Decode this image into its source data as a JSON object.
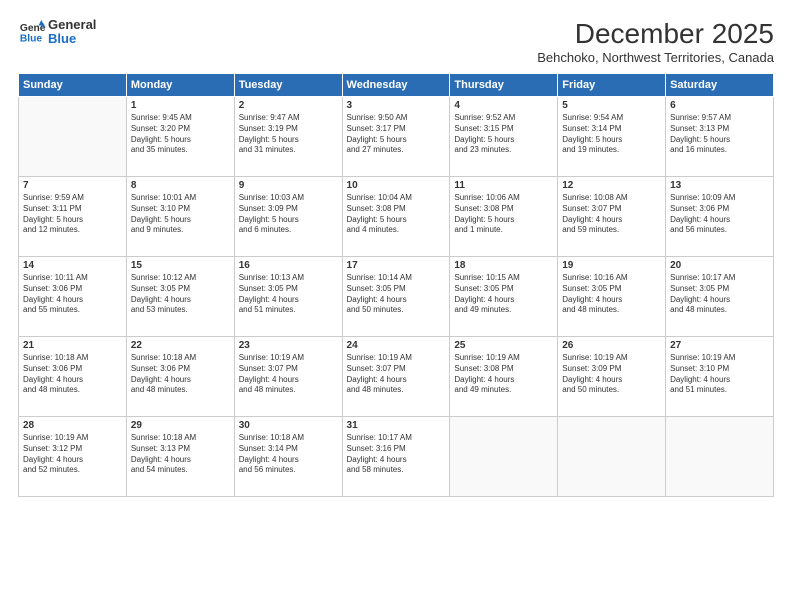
{
  "header": {
    "logo_line1": "General",
    "logo_line2": "Blue",
    "month_year": "December 2025",
    "location": "Behchoko, Northwest Territories, Canada"
  },
  "days_of_week": [
    "Sunday",
    "Monday",
    "Tuesday",
    "Wednesday",
    "Thursday",
    "Friday",
    "Saturday"
  ],
  "weeks": [
    [
      {
        "num": "",
        "info": ""
      },
      {
        "num": "1",
        "info": "Sunrise: 9:45 AM\nSunset: 3:20 PM\nDaylight: 5 hours\nand 35 minutes."
      },
      {
        "num": "2",
        "info": "Sunrise: 9:47 AM\nSunset: 3:19 PM\nDaylight: 5 hours\nand 31 minutes."
      },
      {
        "num": "3",
        "info": "Sunrise: 9:50 AM\nSunset: 3:17 PM\nDaylight: 5 hours\nand 27 minutes."
      },
      {
        "num": "4",
        "info": "Sunrise: 9:52 AM\nSunset: 3:15 PM\nDaylight: 5 hours\nand 23 minutes."
      },
      {
        "num": "5",
        "info": "Sunrise: 9:54 AM\nSunset: 3:14 PM\nDaylight: 5 hours\nand 19 minutes."
      },
      {
        "num": "6",
        "info": "Sunrise: 9:57 AM\nSunset: 3:13 PM\nDaylight: 5 hours\nand 16 minutes."
      }
    ],
    [
      {
        "num": "7",
        "info": "Sunrise: 9:59 AM\nSunset: 3:11 PM\nDaylight: 5 hours\nand 12 minutes."
      },
      {
        "num": "8",
        "info": "Sunrise: 10:01 AM\nSunset: 3:10 PM\nDaylight: 5 hours\nand 9 minutes."
      },
      {
        "num": "9",
        "info": "Sunrise: 10:03 AM\nSunset: 3:09 PM\nDaylight: 5 hours\nand 6 minutes."
      },
      {
        "num": "10",
        "info": "Sunrise: 10:04 AM\nSunset: 3:08 PM\nDaylight: 5 hours\nand 4 minutes."
      },
      {
        "num": "11",
        "info": "Sunrise: 10:06 AM\nSunset: 3:08 PM\nDaylight: 5 hours\nand 1 minute."
      },
      {
        "num": "12",
        "info": "Sunrise: 10:08 AM\nSunset: 3:07 PM\nDaylight: 4 hours\nand 59 minutes."
      },
      {
        "num": "13",
        "info": "Sunrise: 10:09 AM\nSunset: 3:06 PM\nDaylight: 4 hours\nand 56 minutes."
      }
    ],
    [
      {
        "num": "14",
        "info": "Sunrise: 10:11 AM\nSunset: 3:06 PM\nDaylight: 4 hours\nand 55 minutes."
      },
      {
        "num": "15",
        "info": "Sunrise: 10:12 AM\nSunset: 3:05 PM\nDaylight: 4 hours\nand 53 minutes."
      },
      {
        "num": "16",
        "info": "Sunrise: 10:13 AM\nSunset: 3:05 PM\nDaylight: 4 hours\nand 51 minutes."
      },
      {
        "num": "17",
        "info": "Sunrise: 10:14 AM\nSunset: 3:05 PM\nDaylight: 4 hours\nand 50 minutes."
      },
      {
        "num": "18",
        "info": "Sunrise: 10:15 AM\nSunset: 3:05 PM\nDaylight: 4 hours\nand 49 minutes."
      },
      {
        "num": "19",
        "info": "Sunrise: 10:16 AM\nSunset: 3:05 PM\nDaylight: 4 hours\nand 48 minutes."
      },
      {
        "num": "20",
        "info": "Sunrise: 10:17 AM\nSunset: 3:05 PM\nDaylight: 4 hours\nand 48 minutes."
      }
    ],
    [
      {
        "num": "21",
        "info": "Sunrise: 10:18 AM\nSunset: 3:06 PM\nDaylight: 4 hours\nand 48 minutes."
      },
      {
        "num": "22",
        "info": "Sunrise: 10:18 AM\nSunset: 3:06 PM\nDaylight: 4 hours\nand 48 minutes."
      },
      {
        "num": "23",
        "info": "Sunrise: 10:19 AM\nSunset: 3:07 PM\nDaylight: 4 hours\nand 48 minutes."
      },
      {
        "num": "24",
        "info": "Sunrise: 10:19 AM\nSunset: 3:07 PM\nDaylight: 4 hours\nand 48 minutes."
      },
      {
        "num": "25",
        "info": "Sunrise: 10:19 AM\nSunset: 3:08 PM\nDaylight: 4 hours\nand 49 minutes."
      },
      {
        "num": "26",
        "info": "Sunrise: 10:19 AM\nSunset: 3:09 PM\nDaylight: 4 hours\nand 50 minutes."
      },
      {
        "num": "27",
        "info": "Sunrise: 10:19 AM\nSunset: 3:10 PM\nDaylight: 4 hours\nand 51 minutes."
      }
    ],
    [
      {
        "num": "28",
        "info": "Sunrise: 10:19 AM\nSunset: 3:12 PM\nDaylight: 4 hours\nand 52 minutes."
      },
      {
        "num": "29",
        "info": "Sunrise: 10:18 AM\nSunset: 3:13 PM\nDaylight: 4 hours\nand 54 minutes."
      },
      {
        "num": "30",
        "info": "Sunrise: 10:18 AM\nSunset: 3:14 PM\nDaylight: 4 hours\nand 56 minutes."
      },
      {
        "num": "31",
        "info": "Sunrise: 10:17 AM\nSunset: 3:16 PM\nDaylight: 4 hours\nand 58 minutes."
      },
      {
        "num": "",
        "info": ""
      },
      {
        "num": "",
        "info": ""
      },
      {
        "num": "",
        "info": ""
      }
    ]
  ]
}
